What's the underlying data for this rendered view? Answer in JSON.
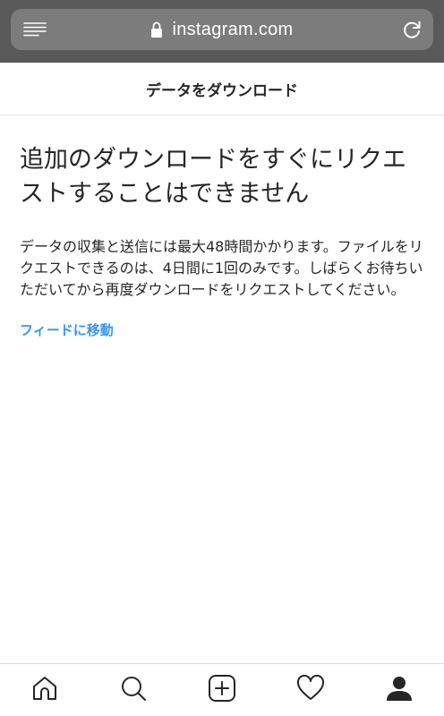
{
  "browser": {
    "url": "instagram.com"
  },
  "header": {
    "title": "データをダウンロード"
  },
  "main": {
    "heading": "追加のダウンロードをすぐにリクエストすることはできません",
    "body": "データの収集と送信には最大48時間かかります。ファイルをリクエストできるのは、4日間に1回のみです。しばらくお待ちいただいてから再度ダウンロードをリクエストしてください。",
    "link_label": "フィードに移動"
  },
  "icons": {
    "reader": "reader-mode-icon",
    "lock": "lock-icon",
    "reload": "reload-icon",
    "home": "home-icon",
    "search": "search-icon",
    "new_post": "new-post-icon",
    "activity": "heart-icon",
    "profile": "profile-icon"
  },
  "colors": {
    "browser_bar": "#595959",
    "url_field": "#7c7c7c",
    "link": "#3897f0",
    "text": "#262626"
  }
}
